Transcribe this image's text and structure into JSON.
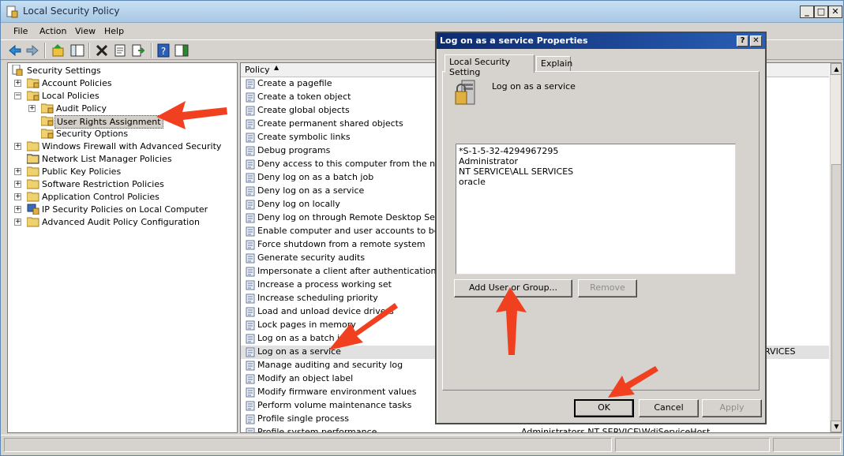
{
  "window": {
    "title": "Local Security Policy",
    "minimize": "_",
    "maximize": "□",
    "close": "✕"
  },
  "menu": [
    "File",
    "Action",
    "View",
    "Help"
  ],
  "tree": {
    "root": "Security Settings",
    "items": [
      "Account Policies",
      "Local Policies",
      "Audit Policy",
      "User Rights Assignment",
      "Security Options",
      "Windows Firewall with Advanced Security",
      "Network List Manager Policies",
      "Public Key Policies",
      "Software Restriction Policies",
      "Application Control Policies",
      "IP Security Policies on Local Computer",
      "Advanced Audit Policy Configuration"
    ]
  },
  "list": {
    "column_policy": "Policy",
    "rows": [
      "Create a pagefile",
      "Create a token object",
      "Create global objects",
      "Create permanent shared objects",
      "Create symbolic links",
      "Debug programs",
      "Deny access to this computer from the network",
      "Deny log on as a batch job",
      "Deny log on as a service",
      "Deny log on locally",
      "Deny log on through Remote Desktop Services",
      "Enable computer and user accounts to be trusted",
      "Force shutdown from a remote system",
      "Generate security audits",
      "Impersonate a client after authentication",
      "Increase a process working set",
      "Increase scheduling priority",
      "Load and unload device drivers",
      "Lock pages in memory",
      "Log on as a batch job",
      "Log on as a service",
      "Manage auditing and security log",
      "Modify an object label",
      "Modify firmware environment values",
      "Perform volume maintenance tasks",
      "Profile single process",
      "Profile system performance"
    ],
    "selected_setting_fragment": "RVICES",
    "last_row_setting": "Administrators,NT SERVICE\\WdiServiceHost"
  },
  "dialog": {
    "title": "Log on as a service Properties",
    "help": "?",
    "close": "✕",
    "tabs": [
      "Local Security Setting",
      "Explain"
    ],
    "policy_name": "Log on as a service",
    "members": [
      "*S-1-5-32-4294967295",
      "Administrator",
      "NT SERVICE\\ALL SERVICES",
      "oracle"
    ],
    "add_button": "Add User or Group...",
    "remove_button": "Remove",
    "ok_button": "OK",
    "cancel_button": "Cancel",
    "apply_button": "Apply"
  },
  "colors": {
    "annotation_arrow": "#f04020",
    "dialog_title": "#0c2a6e"
  }
}
